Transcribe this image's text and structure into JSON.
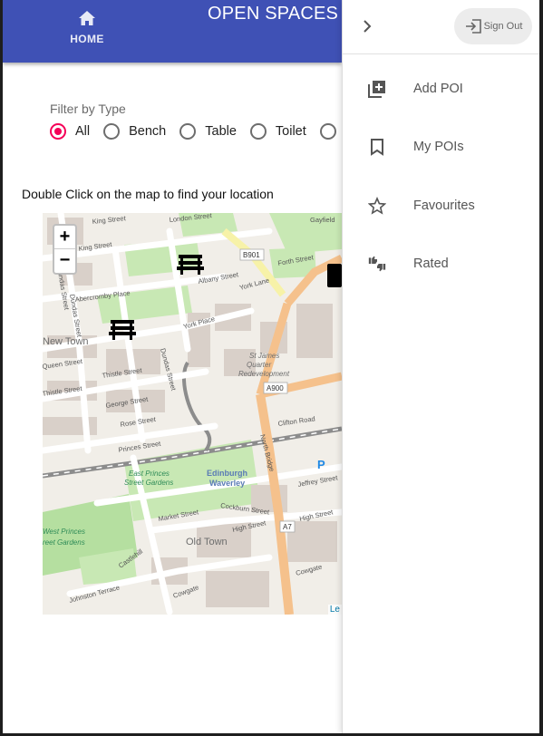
{
  "appbar": {
    "home_label": "HOME",
    "title": "OPEN SPACES",
    "color": "#3f51b5"
  },
  "filter": {
    "label": "Filter by Type",
    "options": [
      {
        "label": "All",
        "checked": true
      },
      {
        "label": "Bench",
        "checked": false
      },
      {
        "label": "Table",
        "checked": false
      },
      {
        "label": "Toilet",
        "checked": false
      },
      {
        "label": "",
        "checked": false
      }
    ],
    "accent": "#f50057"
  },
  "instruction": "Double Click on the map to find your location",
  "map": {
    "zoom_in": "+",
    "zoom_out": "−",
    "attribution": "Le",
    "labels": {
      "london_street": "London Street",
      "gayfield": "Gayfield",
      "king_street": "King Street",
      "dundas_street": "Dundas Street",
      "albany_street": "Albany Street",
      "forth_street": "Forth Street",
      "york_lane": "York Lane",
      "b901": "B901",
      "abercromby_place": "Abercromby Place",
      "york_place": "York Place",
      "new_town": "New Town",
      "queen_street": "Queen Street",
      "thistle_street": "Thistle Street",
      "st_james": "St James",
      "quarter": "Quarter",
      "redevelopment": "Redevelopment",
      "a900": "A900",
      "george_street": "George Street",
      "rose_street": "Rose Street",
      "princes_street": "Princes Street",
      "clifton_road": "Clifton Road",
      "north_bridge": "North Bridge",
      "east_princes": "East Princes",
      "street_gardens": "Street Gardens",
      "edinburgh": "Edinburgh",
      "waverley": "Waverley",
      "jeffrey_street": "Jeffrey Street",
      "market_street": "Market Street",
      "cockburn_street": "Cockburn Street",
      "high_street": "High Street",
      "a7": "A7",
      "west_princes": "West Princes",
      "west_gardens": "reet Gardens",
      "old_town": "Old Town",
      "castlehill": "Castlehill",
      "johnston_terrace": "Johnston Terrace",
      "cowgate": "Cowgate",
      "parking": "P"
    }
  },
  "drawer": {
    "sign_out": "Sign Out",
    "items": [
      {
        "label": "Add POI",
        "icon": "add-box-icon"
      },
      {
        "label": "My POIs",
        "icon": "bookmark-icon"
      },
      {
        "label": "Favourites",
        "icon": "star-outline-icon"
      },
      {
        "label": "Rated",
        "icon": "thumbs-up-down-icon"
      }
    ]
  }
}
